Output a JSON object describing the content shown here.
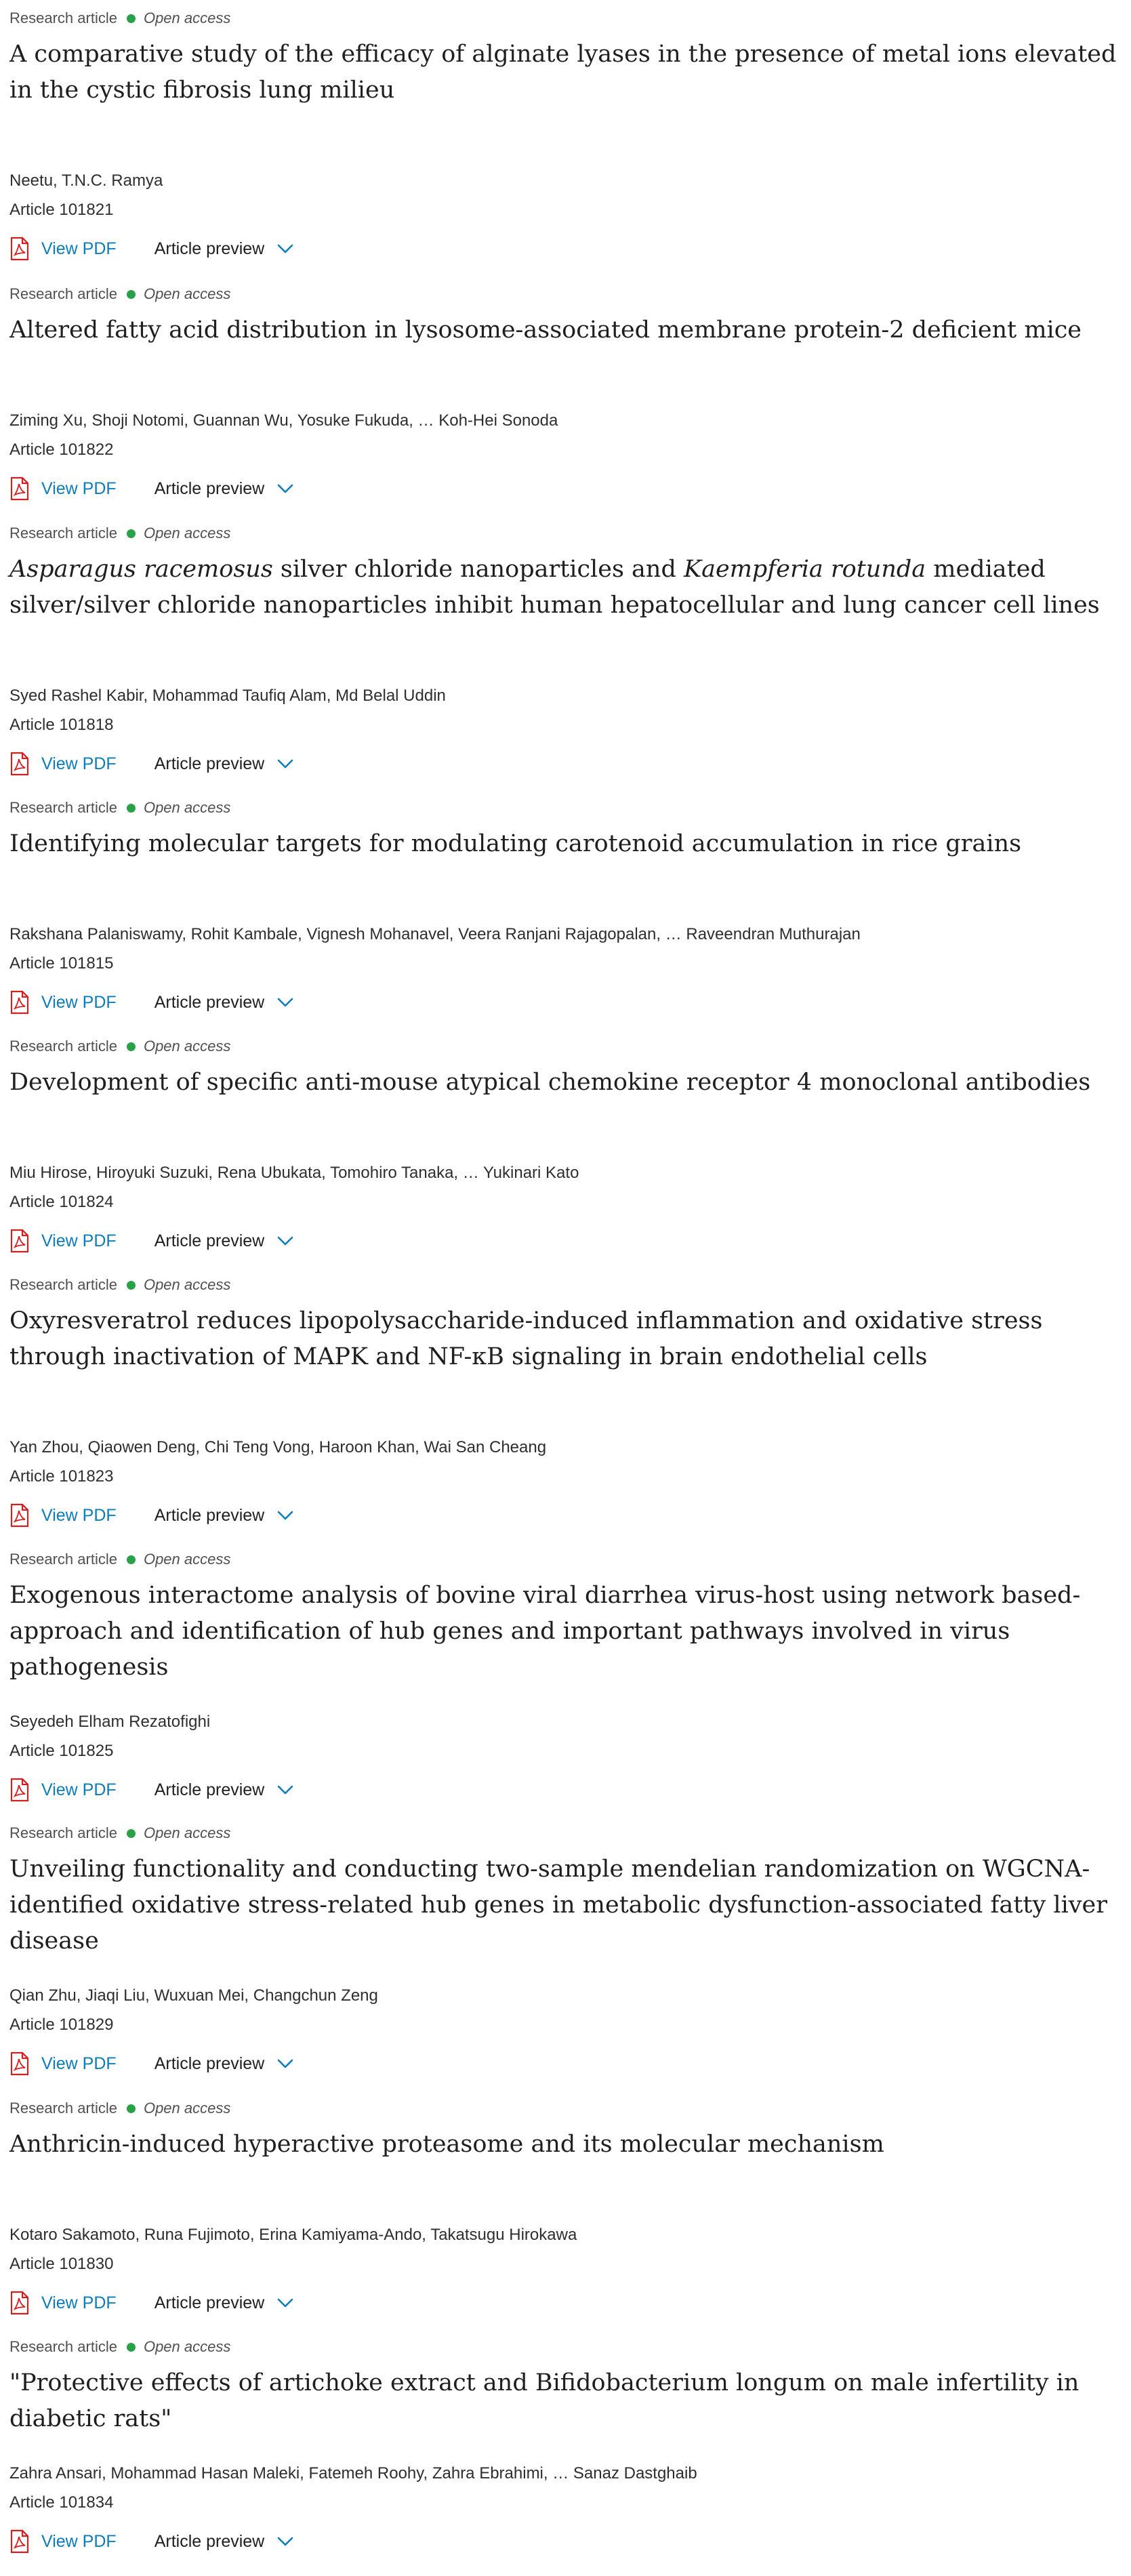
{
  "colors": {
    "accent_link": "#0c7dbb",
    "open_access_dot": "#29a146",
    "pdf_icon": "#d21f1f"
  },
  "labels": {
    "view_pdf": "View PDF",
    "article_preview": "Article preview"
  },
  "articles": [
    {
      "type": "Research article",
      "access": "Open access",
      "title_html": "A comparative study of the efficacy of alginate lyases in the presence of metal ions elevated in the cystic fibrosis lung milieu",
      "authors": "Neetu, T.N.C. Ramya",
      "article_number": "Article 101821"
    },
    {
      "type": "Research article",
      "access": "Open access",
      "title_html": "Altered fatty acid distribution in lysosome-associated membrane protein-2 deficient mice",
      "authors": "Ziming Xu, Shoji Notomi, Guannan Wu, Yosuke Fukuda, … Koh-Hei Sonoda",
      "article_number": "Article 101822"
    },
    {
      "type": "Research article",
      "access": "Open access",
      "title_html": "<i>Asparagus racemosus</i> silver chloride nanoparticles and <i>Kaempferia rotunda</i> mediated silver/silver chloride nanoparticles inhibit human hepatocellular and lung cancer cell lines",
      "authors": "Syed Rashel Kabir, Mohammad Taufiq Alam, Md Belal Uddin",
      "article_number": "Article 101818"
    },
    {
      "type": "Research article",
      "access": "Open access",
      "title_html": "Identifying molecular targets for modulating carotenoid accumulation in rice grains",
      "authors": "Rakshana Palaniswamy, Rohit Kambale, Vignesh Mohanavel, Veera Ranjani Rajagopalan, … Raveendran Muthurajan",
      "article_number": "Article 101815"
    },
    {
      "type": "Research article",
      "access": "Open access",
      "title_html": "Development of specific anti-mouse atypical chemokine receptor 4 monoclonal antibodies",
      "authors": "Miu Hirose, Hiroyuki Suzuki, Rena Ubukata, Tomohiro Tanaka, … Yukinari Kato",
      "article_number": "Article 101824"
    },
    {
      "type": "Research article",
      "access": "Open access",
      "title_html": "Oxyresveratrol reduces lipopolysaccharide-induced inflammation and oxidative stress through inactivation of MAPK and NF-κB signaling in brain endothelial cells",
      "authors": "Yan Zhou, Qiaowen Deng, Chi Teng Vong, Haroon Khan, Wai San Cheang",
      "article_number": "Article 101823"
    },
    {
      "type": "Research article",
      "access": "Open access",
      "title_html": "Exogenous interactome analysis of bovine viral diarrhea virus-host using network based-approach and identification of hub genes and important pathways involved in virus pathogenesis",
      "authors": "Seyedeh Elham Rezatofighi",
      "article_number": "Article 101825"
    },
    {
      "type": "Research article",
      "access": "Open access",
      "title_html": "Unveiling functionality and conducting two-sample mendelian randomization on WGCNA-identified oxidative stress-related hub genes in metabolic dysfunction-associated fatty liver disease",
      "authors": "Qian Zhu, Jiaqi Liu, Wuxuan Mei, Changchun Zeng",
      "article_number": "Article 101829"
    },
    {
      "type": "Research article",
      "access": "Open access",
      "title_html": "Anthricin-induced hyperactive proteasome and its molecular mechanism",
      "authors": "Kotaro Sakamoto, Runa Fujimoto, Erina Kamiyama-Ando, Takatsugu Hirokawa",
      "article_number": "Article 101830"
    },
    {
      "type": "Research article",
      "access": "Open access",
      "title_html": "\"Protective effects of artichoke extract and Bifidobacterium longum on male infertility in diabetic rats\"",
      "authors": "Zahra Ansari, Mohammad Hasan Maleki, Fatemeh Roohy, Zahra Ebrahimi, … Sanaz Dastghaib",
      "article_number": "Article 101834"
    }
  ]
}
